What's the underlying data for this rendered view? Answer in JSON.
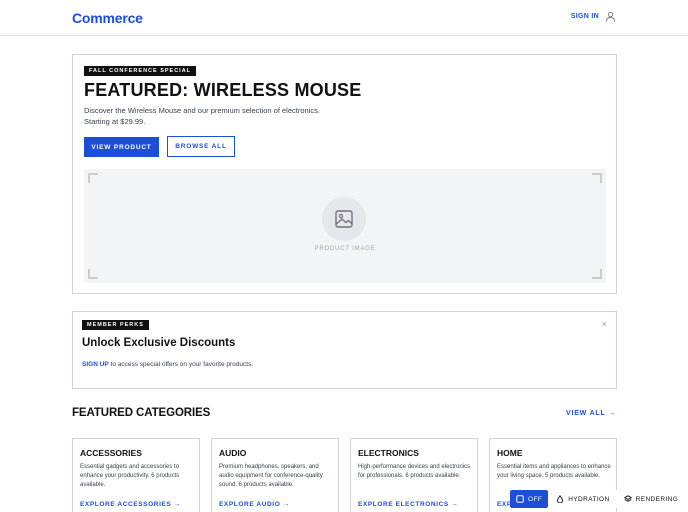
{
  "header": {
    "logo": "Commerce",
    "signin_label": "SIGN IN"
  },
  "hero": {
    "badge": "FALL CONFERENCE SPECIAL",
    "title": "FEATURED: WIRELESS MOUSE",
    "description": "Discover the Wireless Mouse and our premium selection of electronics. Starting at $29.99.",
    "primary_button": "VIEW PRODUCT",
    "secondary_button": "BROWSE ALL",
    "image_caption": "PRODUCT IMAGE"
  },
  "perks": {
    "badge": "MEMBER PERKS",
    "title": "Unlock Exclusive Discounts",
    "signup_link": "SIGN UP",
    "text": "to access special offers on your favorite products.",
    "close": "×"
  },
  "categories": {
    "heading": "FEATURED CATEGORIES",
    "view_all": "VIEW ALL →",
    "items": [
      {
        "title": "ACCESSORIES",
        "description": "Essential gadgets and accessories to enhance your productivity. 6 products available.",
        "link": "EXPLORE ACCESSORIES →"
      },
      {
        "title": "AUDIO",
        "description": "Premium headphones, speakers, and audio equipment for conference-quality sound. 6 products available.",
        "link": "EXPLORE AUDIO →"
      },
      {
        "title": "ELECTRONICS",
        "description": "High-performance devices and electronics for professionals. 6 products available.",
        "link": "EXPLORE ELECTRONICS →"
      },
      {
        "title": "HOME",
        "description": "Essential items and appliances to enhance your living space. 5 products available.",
        "link": "EXP"
      }
    ]
  },
  "devbar": {
    "off_label": "OFF",
    "hydration_label": "HYDRATION",
    "rendering_label": "RENDERING"
  },
  "colors": {
    "accent": "#1d4ed8",
    "text": "#111111",
    "border": "#d1d5db",
    "image_bg": "#f3f4f6"
  },
  "icons": {
    "signin": "user-icon",
    "image_placeholder": "image-icon",
    "off": "square-icon",
    "hydration": "droplet-icon",
    "rendering": "layers-icon"
  }
}
